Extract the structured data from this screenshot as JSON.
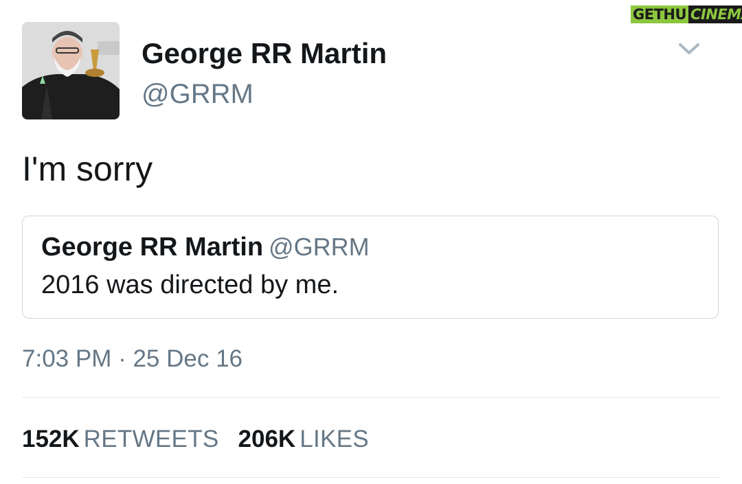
{
  "tweet": {
    "author_name": "George RR Martin",
    "author_handle": "@GRRM",
    "text": "I'm sorry",
    "timestamp": "7:03 PM · 25 Dec 16"
  },
  "quoted_tweet": {
    "author_name": "George RR Martin",
    "author_handle": "@GRRM",
    "text": "2016 was directed by me."
  },
  "stats": {
    "retweets_count": "152K",
    "retweets_label": "RETWEETS",
    "likes_count": "206K",
    "likes_label": "LIKES"
  },
  "watermark": {
    "part1": "GETHU",
    "part2": "CINEMA"
  },
  "icons": {
    "menu": "chevron-down-icon",
    "avatar": "profile-photo"
  },
  "colors": {
    "text_primary": "#14171a",
    "text_secondary": "#657786",
    "border": "#ccd6dd",
    "watermark_green": "#8cc63f"
  }
}
